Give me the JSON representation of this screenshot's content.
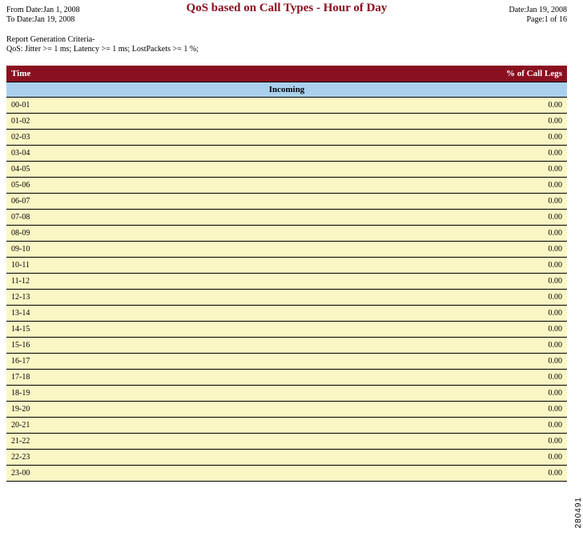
{
  "report": {
    "title": "QoS based on Call Types - Hour of Day",
    "from_date_label": "From Date:Jan 1, 2008",
    "to_date_label": "To Date:Jan 19, 2008",
    "date_label": "Date:Jan 19, 2008",
    "page_label": "Page:1 of 16",
    "criteria_title": "Report Generation Criteria-",
    "criteria_detail": "QoS: Jitter >= 1 ms; Latency >= 1 ms; LostPackets >= 1 %;"
  },
  "columns": {
    "time": "Time",
    "pct": "% of Call Legs"
  },
  "section": {
    "name": "Incoming"
  },
  "rows": [
    {
      "t": "00-01",
      "v": "0.00"
    },
    {
      "t": "01-02",
      "v": "0.00"
    },
    {
      "t": "02-03",
      "v": "0.00"
    },
    {
      "t": "03-04",
      "v": "0.00"
    },
    {
      "t": "04-05",
      "v": "0.00"
    },
    {
      "t": "05-06",
      "v": "0.00"
    },
    {
      "t": "06-07",
      "v": "0.00"
    },
    {
      "t": "07-08",
      "v": "0.00"
    },
    {
      "t": "08-09",
      "v": "0.00"
    },
    {
      "t": "09-10",
      "v": "0.00"
    },
    {
      "t": "10-11",
      "v": "0.00"
    },
    {
      "t": "11-12",
      "v": "0.00"
    },
    {
      "t": "12-13",
      "v": "0.00"
    },
    {
      "t": "13-14",
      "v": "0.00"
    },
    {
      "t": "14-15",
      "v": "0.00"
    },
    {
      "t": "15-16",
      "v": "0.00"
    },
    {
      "t": "16-17",
      "v": "0.00"
    },
    {
      "t": "17-18",
      "v": "0.00"
    },
    {
      "t": "18-19",
      "v": "0.00"
    },
    {
      "t": "19-20",
      "v": "0.00"
    },
    {
      "t": "20-21",
      "v": "0.00"
    },
    {
      "t": "21-22",
      "v": "0.00"
    },
    {
      "t": "22-23",
      "v": "0.00"
    },
    {
      "t": "23-00",
      "v": "0.00"
    }
  ],
  "side_code": "280491",
  "chart_data": {
    "type": "table",
    "title": "QoS based on Call Types - Hour of Day",
    "xlabel": "Time",
    "ylabel": "% of Call Legs",
    "categories": [
      "00-01",
      "01-02",
      "02-03",
      "03-04",
      "04-05",
      "05-06",
      "06-07",
      "07-08",
      "08-09",
      "09-10",
      "10-11",
      "11-12",
      "12-13",
      "13-14",
      "14-15",
      "15-16",
      "16-17",
      "17-18",
      "18-19",
      "19-20",
      "20-21",
      "21-22",
      "22-23",
      "23-00"
    ],
    "series": [
      {
        "name": "Incoming",
        "values": [
          0.0,
          0.0,
          0.0,
          0.0,
          0.0,
          0.0,
          0.0,
          0.0,
          0.0,
          0.0,
          0.0,
          0.0,
          0.0,
          0.0,
          0.0,
          0.0,
          0.0,
          0.0,
          0.0,
          0.0,
          0.0,
          0.0,
          0.0,
          0.0
        ]
      }
    ]
  }
}
